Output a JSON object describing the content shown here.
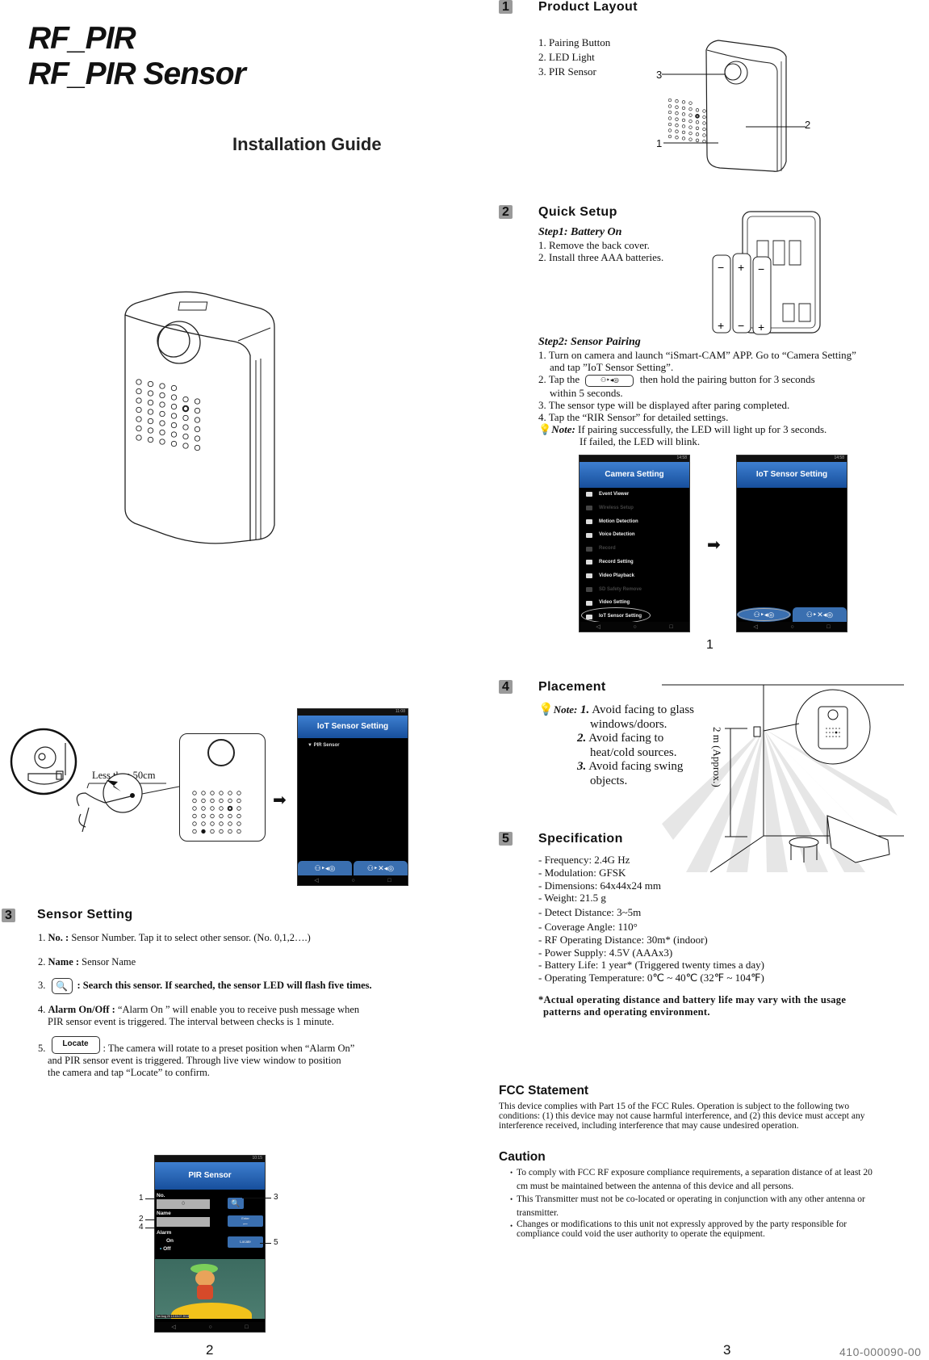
{
  "header": {
    "title_line1": "RF_PIR",
    "title_line2": "RF_PIR Sensor",
    "subtitle": "Installation Guide"
  },
  "section1": {
    "number": "1",
    "title": "Product Layout",
    "items": [
      "1. Pairing Button",
      "2. LED Light",
      "3. PIR Sensor"
    ],
    "callouts": [
      "3",
      "2",
      "1"
    ]
  },
  "section2": {
    "number": "2",
    "title": "Quick Setup",
    "step1": {
      "heading": "Step1: Battery On",
      "items": [
        "1. Remove the back cover.",
        "2. Install three AAA batteries."
      ]
    },
    "battery_marks": [
      "−",
      "+",
      "−",
      "+",
      "−",
      "+"
    ],
    "step2": {
      "heading": "Step2: Sensor Pairing",
      "item1_line1": "1. Turn on camera and launch “iSmart-CAM” APP. Go to “Camera Setting”",
      "item1_line2": "and tap ”IoT Sensor Setting”.",
      "item2_pre": "2. Tap the",
      "item2_post": "then hold the pairing button for 3 seconds",
      "item2_line2": "within 5 seconds.",
      "item3": "3. The sensor type will be displayed after paring completed.",
      "item4": "4. Tap the “RIR Sensor” for detailed settings.",
      "note_label": "Note:",
      "note_line1": "If pairing successfully, the LED will light up for 3 seconds.",
      "note_line2": "If failed, the LED will blink."
    },
    "camera_setting_screen": {
      "status_time": "14:58",
      "title": "Camera Setting",
      "menu": [
        {
          "label": "Event Viewer",
          "enabled": true
        },
        {
          "label": "Wireless Setup",
          "enabled": false
        },
        {
          "label": "Motion Detection",
          "enabled": true
        },
        {
          "label": "Voice Detection",
          "enabled": true
        },
        {
          "label": "Record",
          "enabled": false
        },
        {
          "label": "Record Setting",
          "enabled": true
        },
        {
          "label": "Video Playback",
          "enabled": true
        },
        {
          "label": "SD Safety Remove",
          "enabled": false
        },
        {
          "label": "Video Setting",
          "enabled": true
        },
        {
          "label": "IoT Sensor Setting",
          "enabled": true,
          "highlighted": true
        }
      ]
    },
    "iot_screen": {
      "status_time": "14:58",
      "title": "IoT Sensor Setting",
      "pair_button": "⚇‣◂◎",
      "unpair_button": "⚇‣✕◂◎"
    },
    "figure_label": "1"
  },
  "section3_figure": {
    "distance_label": "Less than 50cm",
    "iot_screen": {
      "status_time": "11:08",
      "title": "IoT Sensor Setting",
      "sensor_item": "PIR Sensor",
      "pair_button": "⚇‣◂◎",
      "unpair_button": "⚇‣✕◂◎"
    }
  },
  "section3": {
    "number": "3",
    "title": "Sensor Setting",
    "item1_prefix": "1. ",
    "item1_bold": "No. :",
    "item1_text": " Sensor Number. Tap it to select other sensor. (No. 0,1,2….)",
    "item2_prefix": "2. ",
    "item2_bold": "Name :",
    "item2_text": " Sensor Name",
    "item3_prefix": "3.",
    "item3_text": ": Search this sensor. If searched, the sensor LED will flash five times.",
    "item4_prefix": "4. ",
    "item4_bold": "Alarm On/Off :",
    "item4_text": " “Alarm On ” will enable you to receive push message when",
    "item4_line2": "PIR sensor event is triggered. The interval between checks is 1 minute.",
    "item5_prefix": "5.",
    "item5_button": "Locate",
    "item5_text": ": The camera will rotate to a preset position when “Alarm On”",
    "item5_line2": "and PIR sensor event is triggered. Through live view window to position",
    "item5_line3": "the camera and tap “Locate” to confirm."
  },
  "pir_screen": {
    "status_time": "10:15",
    "title": "PIR Sensor",
    "no_label": "No.",
    "no_value": "0",
    "name_label": "Name",
    "name_value": "",
    "alarm_label": "Alarm",
    "alarm_on": "On",
    "alarm_off": "Off",
    "alarm_selected": "Off",
    "enter_button": "Enter",
    "locate_button": "Locate",
    "callouts": [
      "1",
      "2",
      "4",
      "3",
      "5"
    ],
    "timestamp": "Tue Aug 20 10:15:07 2013"
  },
  "section4": {
    "number": "4",
    "title": "Placement",
    "note_label": "Note:",
    "notes": [
      {
        "num": "1.",
        "line1": "Avoid facing to glass",
        "line2": "windows/doors."
      },
      {
        "num": "2.",
        "line1": "Avoid facing to",
        "line2": "heat/cold sources."
      },
      {
        "num": "3.",
        "line1": "Avoid facing swing",
        "line2": "objects."
      }
    ],
    "height_label": "2 m (Approx.)"
  },
  "section5": {
    "number": "5",
    "title": "Specification",
    "specs": [
      "- Frequency: 2.4G Hz",
      "- Modulation: GFSK",
      "- Dimensions: 64x44x24 mm",
      "- Weight: 21.5 g",
      "- Detect Distance: 3~5m",
      "- Coverage Angle: 110°",
      "- RF Operating Distance: 30m* (indoor)",
      "- Power Supply: 4.5V (AAAx3)",
      "- Battery Life: 1 year* (Triggered twenty times a day)",
      "- Operating Temperature: 0℃ ~ 40℃ (32℉ ~ 104℉)"
    ],
    "footnote_line1": "*Actual operating distance and battery life may vary with the usage",
    "footnote_line2": "patterns and operating environment."
  },
  "fcc": {
    "title": "FCC Statement",
    "line1": "This device complies with Part 15 of the FCC Rules. Operation is subject to the following two",
    "line2": "conditions: (1) this device may not cause harmful interference, and (2) this device must accept any",
    "line3": "interference received, including interference that may cause undesired operation."
  },
  "caution": {
    "title": "Caution",
    "items": [
      {
        "line1": "To comply with FCC RF exposure compliance requirements, a separation distance of at least 20",
        "line2": "cm must be maintained between the antenna of this device and all persons."
      },
      {
        "line1": "This Transmitter must not be co-located or operating in conjunction with any other antenna or",
        "line2": "transmitter."
      },
      {
        "line1": "Changes or modifications to this unit not expressly approved by the party responsible for",
        "line2": "compliance could void the user authority to operate the equipment."
      }
    ]
  },
  "footer": {
    "page_left": "2",
    "page_right": "3",
    "doc_number": "410-000090-00"
  }
}
